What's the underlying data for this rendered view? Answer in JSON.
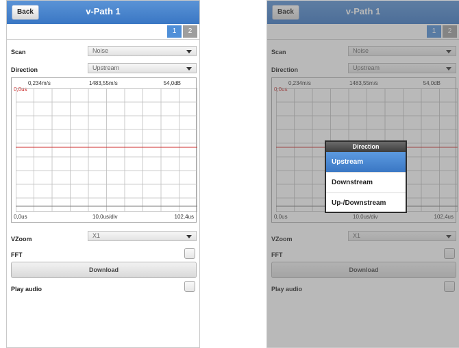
{
  "header": {
    "back_label": "Back",
    "title": "v-Path 1"
  },
  "tabs": [
    {
      "label": "1"
    },
    {
      "label": "2"
    }
  ],
  "scan": {
    "label": "Scan",
    "value": "Noise"
  },
  "direction": {
    "label": "Direction",
    "value": "Upstream"
  },
  "plot": {
    "top_left": "0,234m/s",
    "top_center": "1483,55m/s",
    "top_right": "54,0dB",
    "time_marker": "0,0us",
    "bottom_left": "0,0us",
    "bottom_center": "10,0us/div",
    "bottom_right": "102,4us"
  },
  "vzoom": {
    "label": "VZoom",
    "value": "X1"
  },
  "fft": {
    "label": "FFT",
    "checked": false
  },
  "download_label": "Download",
  "play_audio": {
    "label": "Play audio",
    "checked": false
  },
  "direction_dialog": {
    "title": "Direction",
    "options": [
      "Upstream",
      "Downstream",
      "Up-/Downstream"
    ],
    "selected": "Upstream"
  },
  "colors": {
    "header": "#3a77c4",
    "tab_active": "#4f8fd8",
    "signal_line": "#cc2b2b"
  }
}
